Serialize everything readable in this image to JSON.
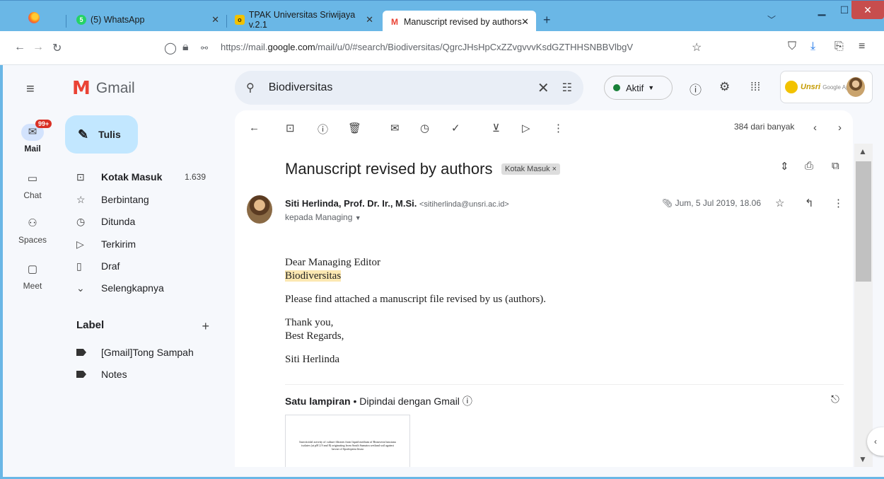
{
  "browser": {
    "tabs": [
      {
        "label": "(5) WhatsApp",
        "icon": "whatsapp-icon"
      },
      {
        "label": "TPAK Universitas Sriwijaya v.2.1",
        "icon": "tpak-icon"
      },
      {
        "label": "Manuscript revised by authors -",
        "icon": "gmail-icon"
      }
    ],
    "url_prefix": "https://mail.",
    "url_domain": "google.com",
    "url_path": "/mail/u/0/#search/Biodiversitas/QgrcJHsHpCxZZvgvvvKsdGZTHHSNBBVlbgV"
  },
  "rail": [
    {
      "label": "Mail",
      "icon": "mail-icon",
      "badge": "99+"
    },
    {
      "label": "Chat",
      "icon": "chat-icon"
    },
    {
      "label": "Spaces",
      "icon": "spaces-icon"
    },
    {
      "label": "Meet",
      "icon": "meet-icon"
    }
  ],
  "app_name": "Gmail",
  "compose_label": "Tulis",
  "folders": [
    {
      "label": "Kotak Masuk",
      "count": "1.639",
      "icon": "inbox-icon"
    },
    {
      "label": "Berbintang",
      "icon": "star-icon"
    },
    {
      "label": "Ditunda",
      "icon": "clock-icon"
    },
    {
      "label": "Terkirim",
      "icon": "send-icon"
    },
    {
      "label": "Draf",
      "icon": "draft-icon"
    },
    {
      "label": "Selengkapnya",
      "icon": "chevron-down-icon"
    }
  ],
  "labels_heading": "Label",
  "labels": [
    "[Gmail]Tong Sampah",
    "Notes"
  ],
  "search": {
    "query": "Biodiversitas"
  },
  "status": "Aktif",
  "account_brand": "Unsri",
  "account_sub": "Google Apps",
  "pager": "384 dari banyak",
  "email": {
    "subject": "Manuscript revised by authors",
    "chip": "Kotak Masuk",
    "sender_name": "Siti Herlinda, Prof. Dr. Ir., M.Si.",
    "sender_email": "<sitiherlinda@unsri.ac.id>",
    "to": "kepada Managing",
    "date": "Jum, 5 Jul 2019, 18.06",
    "body": {
      "greeting": "Dear Managing Editor",
      "journal": "Biodiversitas",
      "line1": "Please find attached a manuscript file revised by us (authors).",
      "thanks": "Thank you,",
      "regards": "Best Regards,",
      "signature": "Siti Herlinda"
    },
    "attachment_title": "Satu lampiran",
    "attachment_sub": "Dipindai dengan Gmail",
    "thumb_text": "Insecticidal activity of culture filtrates from liquid medium of Beauveria bassiana isolates (at pH 2.9 and 8) originating from South Sumatra wetland soil against larvae of Spodoptera litura"
  }
}
